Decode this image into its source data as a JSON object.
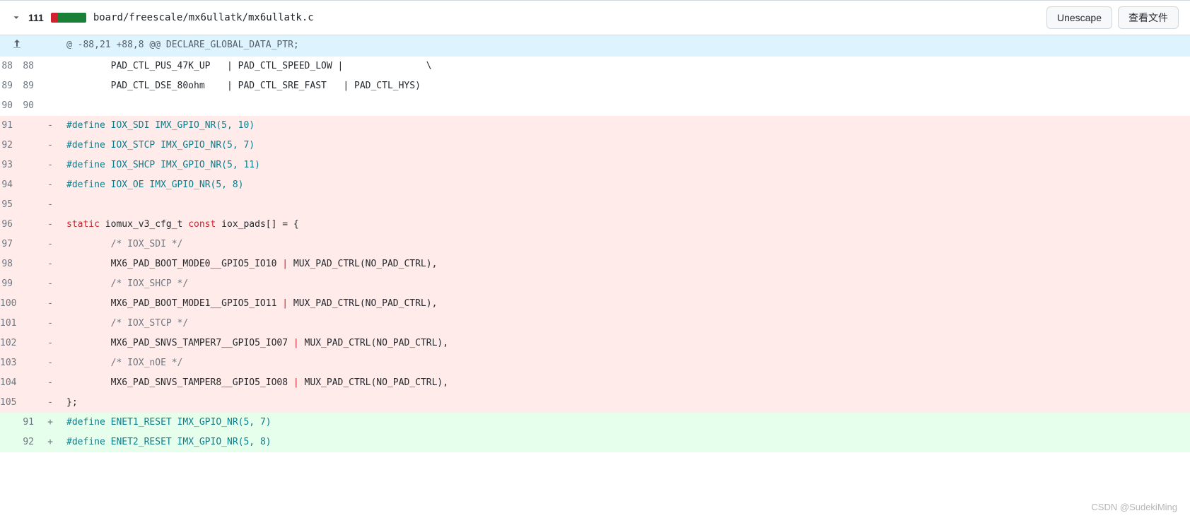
{
  "header": {
    "change_count": "111",
    "file_path": "board/freescale/mx6ullatk/mx6ullatk.c",
    "unescape_label": "Unescape",
    "view_file_label": "查看文件"
  },
  "hunk_header": "@ -88,21 +88,8 @@ DECLARE_GLOBAL_DATA_PTR;",
  "rows": [
    {
      "old": "88",
      "new": "88",
      "type": "ctx",
      "plain": "        PAD_CTL_PUS_47K_UP   | PAD_CTL_SPEED_LOW |               \\"
    },
    {
      "old": "89",
      "new": "89",
      "type": "ctx",
      "plain": "        PAD_CTL_DSE_80ohm    | PAD_CTL_SRE_FAST   | PAD_CTL_HYS)"
    },
    {
      "old": "90",
      "new": "90",
      "type": "ctx",
      "plain": ""
    },
    {
      "old": "91",
      "new": "",
      "type": "del",
      "html": "<span class=\"tok-teal\">#define</span> <span class=\"tok-teal\">IOX_SDI</span> <span class=\"tok-teal\">IMX_GPIO_NR(5, 10)</span>"
    },
    {
      "old": "92",
      "new": "",
      "type": "del",
      "html": "<span class=\"tok-teal\">#define</span> <span class=\"tok-teal\">IOX_STCP</span> <span class=\"tok-teal\">IMX_GPIO_NR(5, 7)</span>"
    },
    {
      "old": "93",
      "new": "",
      "type": "del",
      "html": "<span class=\"tok-teal\">#define</span> <span class=\"tok-teal\">IOX_SHCP</span> <span class=\"tok-teal\">IMX_GPIO_NR(5, 11)</span>"
    },
    {
      "old": "94",
      "new": "",
      "type": "del",
      "html": "<span class=\"tok-teal\">#define</span> <span class=\"tok-teal\">IOX_OE</span> <span class=\"tok-teal\">IMX_GPIO_NR(5, 8)</span>"
    },
    {
      "old": "95",
      "new": "",
      "type": "del",
      "plain": ""
    },
    {
      "old": "96",
      "new": "",
      "type": "del",
      "html": "<span class=\"tok-kw\">static</span> iomux_v3_cfg_t <span class=\"tok-kw\">const</span> iox_pads[] = {"
    },
    {
      "old": "97",
      "new": "",
      "type": "del",
      "html": "        <span class=\"tok-cmt\">/* IOX_SDI */</span>"
    },
    {
      "old": "98",
      "new": "",
      "type": "del",
      "html": "        MX6_PAD_BOOT_MODE0__GPIO5_IO10 <span class=\"tok-op\">|</span> MUX_PAD_CTRL(NO_PAD_CTRL),"
    },
    {
      "old": "99",
      "new": "",
      "type": "del",
      "html": "        <span class=\"tok-cmt\">/* IOX_SHCP */</span>"
    },
    {
      "old": "100",
      "new": "",
      "type": "del",
      "html": "        MX6_PAD_BOOT_MODE1__GPIO5_IO11 <span class=\"tok-op\">|</span> MUX_PAD_CTRL(NO_PAD_CTRL),"
    },
    {
      "old": "101",
      "new": "",
      "type": "del",
      "html": "        <span class=\"tok-cmt\">/* IOX_STCP */</span>"
    },
    {
      "old": "102",
      "new": "",
      "type": "del",
      "html": "        MX6_PAD_SNVS_TAMPER7__GPIO5_IO07 <span class=\"tok-op\">|</span> MUX_PAD_CTRL(NO_PAD_CTRL),"
    },
    {
      "old": "103",
      "new": "",
      "type": "del",
      "html": "        <span class=\"tok-cmt\">/* IOX_nOE */</span>"
    },
    {
      "old": "104",
      "new": "",
      "type": "del",
      "html": "        MX6_PAD_SNVS_TAMPER8__GPIO5_IO08 <span class=\"tok-op\">|</span> MUX_PAD_CTRL(NO_PAD_CTRL),"
    },
    {
      "old": "105",
      "new": "",
      "type": "del",
      "plain": "};"
    },
    {
      "old": "",
      "new": "91",
      "type": "add",
      "html": "<span class=\"tok-teal\">#define</span> <span class=\"tok-teal\">ENET1_RESET</span> <span class=\"tok-teal\">IMX_GPIO_NR(5, 7)</span>"
    },
    {
      "old": "",
      "new": "92",
      "type": "add",
      "html": "<span class=\"tok-teal\">#define</span> <span class=\"tok-teal\">ENET2_RESET</span> <span class=\"tok-teal\">IMX_GPIO_NR(5, 8)</span>"
    }
  ],
  "watermark": "CSDN @SudekiMing"
}
